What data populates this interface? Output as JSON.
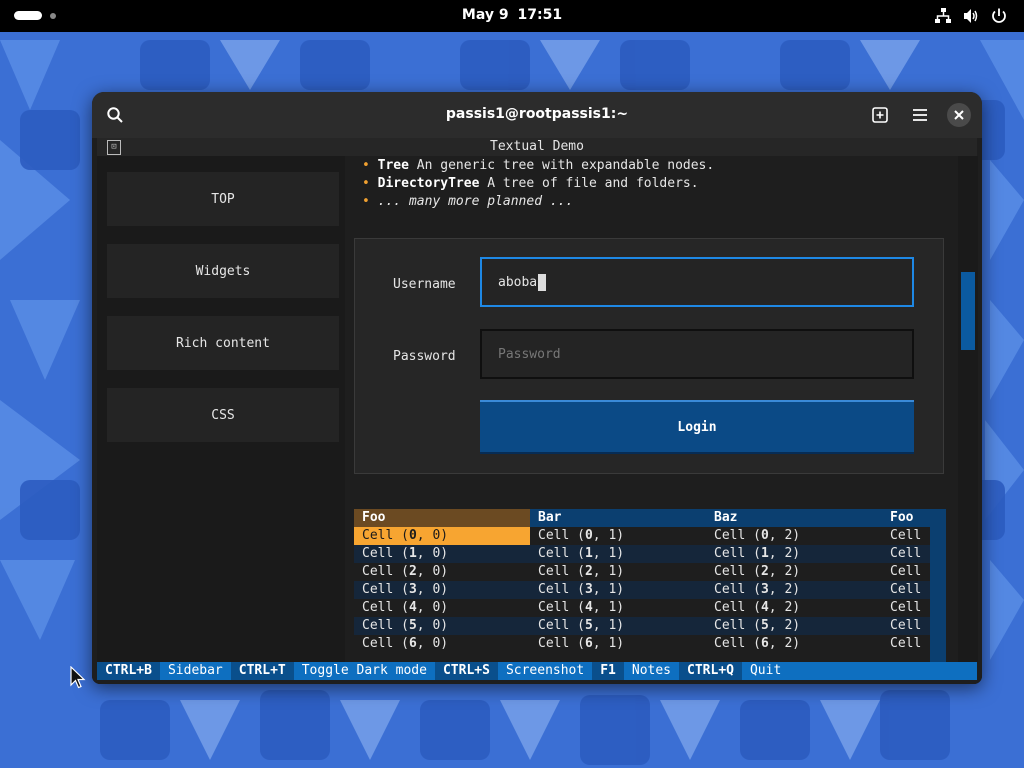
{
  "topbar": {
    "date": "May 9",
    "time": "17:51",
    "icons": [
      "network-icon",
      "volume-icon",
      "power-icon"
    ]
  },
  "window": {
    "title": "passis1@rootpassis1:~",
    "buttons": [
      "search-icon",
      "new-tab-icon",
      "menu-icon",
      "close-icon"
    ]
  },
  "app": {
    "title": "Textual Demo",
    "sidebar": [
      "TOP",
      "Widgets",
      "Rich content",
      "CSS"
    ],
    "bullets": [
      {
        "bold": "Tree",
        "text": " An generic tree with expandable nodes."
      },
      {
        "bold": "DirectoryTree",
        "text": " A tree of file and folders."
      },
      {
        "bold": "",
        "italic": "... many more planned ..."
      }
    ],
    "login": {
      "username_label": "Username",
      "username_value": "aboba",
      "password_label": "Password",
      "password_placeholder": "Password",
      "login_button": "Login"
    },
    "table": {
      "columns": [
        "Foo",
        "Bar",
        "Baz",
        "Foo"
      ],
      "rows": [
        [
          [
            "0",
            "0"
          ],
          [
            "0",
            "1"
          ],
          [
            "0",
            "2"
          ]
        ],
        [
          [
            "1",
            "0"
          ],
          [
            "1",
            "1"
          ],
          [
            "1",
            "2"
          ]
        ],
        [
          [
            "2",
            "0"
          ],
          [
            "2",
            "1"
          ],
          [
            "2",
            "2"
          ]
        ],
        [
          [
            "3",
            "0"
          ],
          [
            "3",
            "1"
          ],
          [
            "3",
            "2"
          ]
        ],
        [
          [
            "4",
            "0"
          ],
          [
            "4",
            "1"
          ],
          [
            "4",
            "2"
          ]
        ],
        [
          [
            "5",
            "0"
          ],
          [
            "5",
            "1"
          ],
          [
            "5",
            "2"
          ]
        ],
        [
          [
            "6",
            "0"
          ],
          [
            "6",
            "1"
          ],
          [
            "6",
            "2"
          ]
        ]
      ],
      "cell_prefix": "Cell",
      "truncated_cell": "Cell",
      "selected": [
        0,
        0
      ]
    },
    "footer": [
      {
        "key": "CTRL+B",
        "desc": "Sidebar"
      },
      {
        "key": "CTRL+T",
        "desc": "Toggle Dark mode"
      },
      {
        "key": "CTRL+S",
        "desc": "Screenshot"
      },
      {
        "key": "F1",
        "desc": "Notes"
      },
      {
        "key": "CTRL+Q",
        "desc": "Quit"
      }
    ]
  },
  "colors": {
    "accent": "#0e6fc0",
    "selected_cell": "#f7a531",
    "focus_border": "#1e88e5",
    "login_button": "#0b4a86"
  }
}
